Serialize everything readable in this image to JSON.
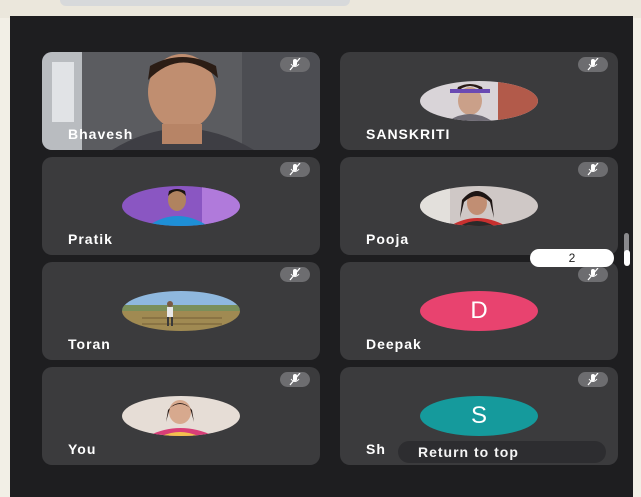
{
  "participants": [
    {
      "name": "Bhavesh"
    },
    {
      "name": "SANSKRITI"
    },
    {
      "name": "Pratik"
    },
    {
      "name": "Pooja"
    },
    {
      "name": "Toran"
    },
    {
      "name": "Deepak",
      "initial": "D",
      "color": "#e8436f"
    },
    {
      "name": "You"
    },
    {
      "name": "Sh",
      "initial": "S",
      "color": "#159a9c"
    }
  ],
  "pagination": {
    "current_page": "2"
  },
  "return_to_top_label": "Return to top"
}
